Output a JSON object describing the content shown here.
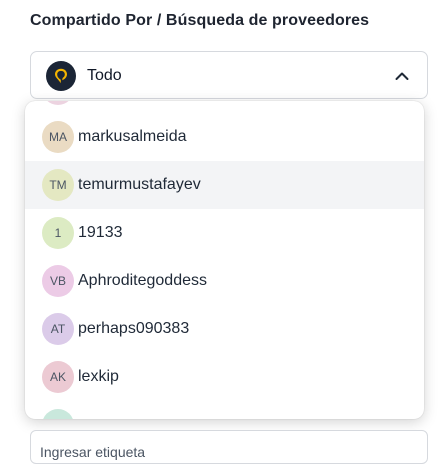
{
  "section_title": "Compartido Por / Búsqueda de proveedores",
  "select": {
    "value": "Todo",
    "logo_icon": "location-pin-logo-icon",
    "toggle_icon": "chevron-up-icon"
  },
  "dropdown": {
    "options": [
      {
        "initials": "",
        "label": "",
        "color": "#ecd3e0"
      },
      {
        "initials": "MA",
        "label": "markusalmeida",
        "color": "#eadbc3"
      },
      {
        "initials": "TM",
        "label": "temurmustafayev",
        "color": "#e4e8c2"
      },
      {
        "initials": "1",
        "label": "19133",
        "color": "#dcebc3"
      },
      {
        "initials": "VB",
        "label": "Aphroditegoddess",
        "color": "#eccbe6"
      },
      {
        "initials": "AT",
        "label": "perhaps090383",
        "color": "#dbcbe9"
      },
      {
        "initials": "AK",
        "label": "lexkip",
        "color": "#eccad3"
      },
      {
        "initials": "",
        "label": "",
        "color": "#c9e8dc"
      }
    ]
  },
  "tag_input": {
    "placeholder": "Ingresar etiqueta"
  }
}
